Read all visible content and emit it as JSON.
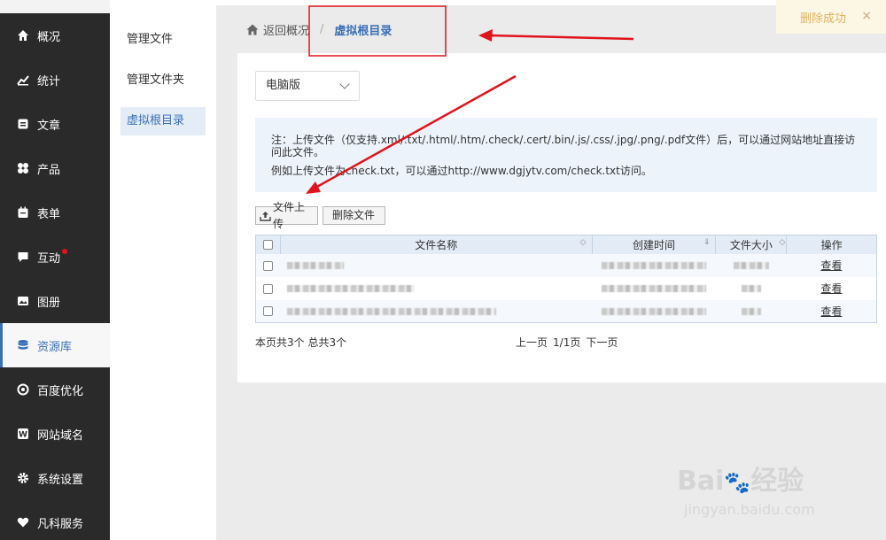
{
  "nav": {
    "items": [
      {
        "label": "概况",
        "icon": "home-icon"
      },
      {
        "label": "统计",
        "icon": "chart-icon"
      },
      {
        "label": "文章",
        "icon": "article-icon"
      },
      {
        "label": "产品",
        "icon": "product-icon"
      },
      {
        "label": "表单",
        "icon": "form-icon"
      },
      {
        "label": "互动",
        "icon": "chat-icon",
        "badge": true
      },
      {
        "label": "图册",
        "icon": "album-icon"
      },
      {
        "label": "资源库",
        "icon": "database-icon",
        "active": true
      },
      {
        "label": "百度优化",
        "icon": "seo-icon"
      },
      {
        "label": "网站域名",
        "icon": "domain-icon"
      },
      {
        "label": "系统设置",
        "icon": "gear-icon"
      },
      {
        "label": "凡科服务",
        "icon": "heart-icon"
      }
    ]
  },
  "subnav": {
    "items": [
      {
        "label": "管理文件"
      },
      {
        "label": "管理文件夹"
      },
      {
        "label": "虚拟根目录",
        "active": true
      }
    ]
  },
  "breadcrumb": {
    "back": "返回概况",
    "separator": "/",
    "current": "虚拟根目录"
  },
  "toast": {
    "text": "删除成功",
    "close": "×"
  },
  "platform_select": {
    "value": "电脑版"
  },
  "note": {
    "line1": "注：上传文件（仅支持.xml/.txt/.html/.htm/.check/.cert/.bin/.js/.css/.jpg/.png/.pdf文件）后，可以通过网站地址直接访问此文件。",
    "line2": "例如上传文件为check.txt，可以通过http://www.dgjytv.com/check.txt访问。"
  },
  "toolbar": {
    "upload": "文件上传",
    "delete": "删除文件"
  },
  "table": {
    "headers": {
      "name": "文件名称",
      "created": "创建时间",
      "size": "文件大小",
      "action": "操作"
    },
    "rows": [
      {
        "action": "查看"
      },
      {
        "action": "查看"
      },
      {
        "action": "查看"
      }
    ]
  },
  "footer": {
    "count": "本页共3个 总共3个",
    "prev": "上一页",
    "page": "1/1页",
    "next": "下一页"
  },
  "watermark": {
    "brand": "Bai",
    "brand2": "经验",
    "site": "jingyan.baidu.com"
  },
  "colors": {
    "accent": "#3a6fb6",
    "nav_bg": "#2a2a2a",
    "annotation": "#e0141d"
  }
}
